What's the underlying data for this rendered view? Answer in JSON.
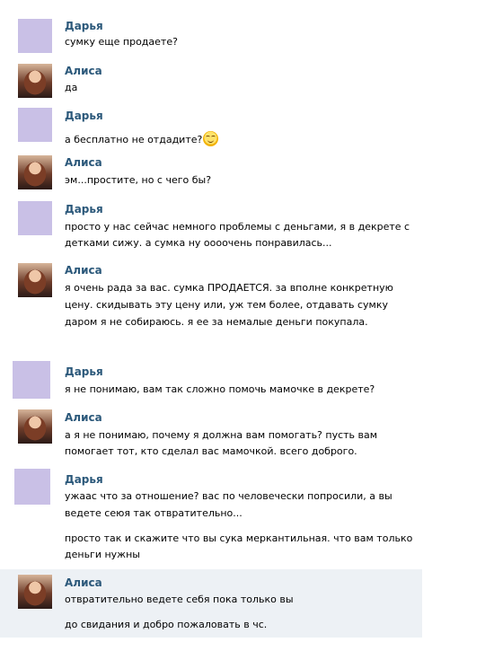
{
  "messages": [
    {
      "author": "Дарья",
      "lines": [
        "сумку еще продаете?"
      ]
    },
    {
      "author": "Алиса",
      "lines": [
        "да"
      ]
    },
    {
      "author": "Дарья",
      "lines": [
        "а бесплатно не отдадите?"
      ],
      "emoji": "smile-icon"
    },
    {
      "author": "Алиса",
      "lines": [
        "эм...простите, но с чего бы?"
      ]
    },
    {
      "author": "Дарья",
      "lines": [
        "просто у нас сейчас немного проблемы с деньгами, я в декрете с",
        "детками сижу. а сумка ну оооочень понравилась..."
      ]
    },
    {
      "author": "Алиса",
      "lines": [
        "я очень рада за вас. сумка ПРОДАЕТСЯ. за вполне конкретную",
        "цену. скидывать эту цену или, уж тем более, отдавать сумку",
        "даром я не собираюсь. я ее за немалые деньги покупала."
      ]
    },
    {
      "author": "Дарья",
      "lines": [
        "я не понимаю, вам так сложно помочь мамочке в декрете?"
      ]
    },
    {
      "author": "Алиса",
      "lines": [
        "а я не понимаю, почему я должна вам помогать? пусть вам",
        "помогает тот, кто сделал вас мамочкой. всего доброго."
      ]
    },
    {
      "author": "Дарья",
      "lines": [
        "ужаас что за отношение? вас по человечески попросили, а вы",
        "ведете сеюя так отвратительно...",
        "просто так и скажите что вы сука меркантильная. что вам только",
        "деньги нужны"
      ]
    },
    {
      "author": "Алиса",
      "lines": [
        "отвратительно ведете себя пока только вы",
        "до свидания и добро пожаловать в чс."
      ]
    }
  ],
  "colors": {
    "name": "#2b587a",
    "highlight": "#edf1f5",
    "daria_avatar": "#c9c0e6"
  }
}
